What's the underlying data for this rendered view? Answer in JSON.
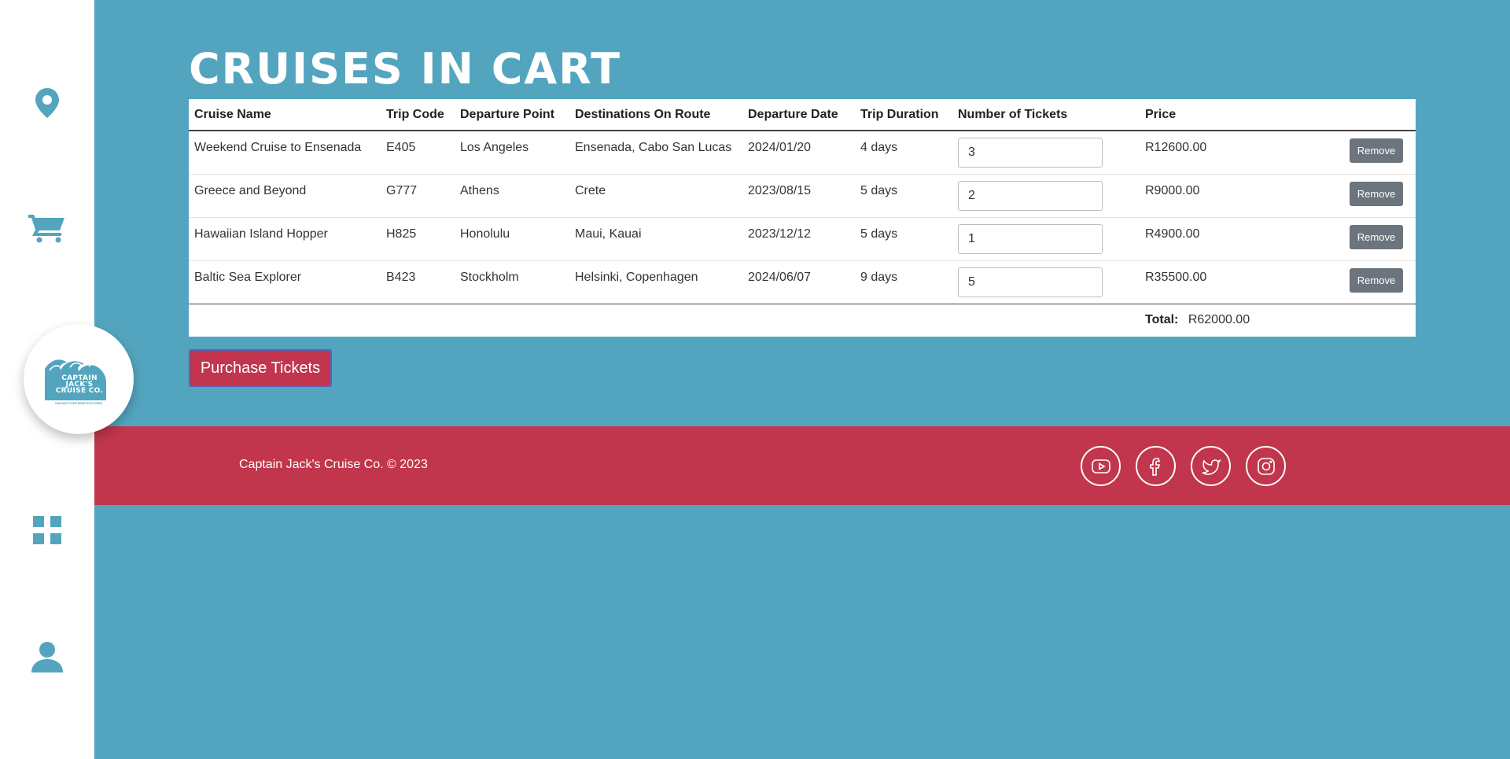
{
  "title": "Cruises in Cart",
  "brand": {
    "logo_line1": "CAPTAIN",
    "logo_line2": "JACK'S",
    "logo_line3": "CRUISE CO.",
    "logo_tagline": "UNLEASH YOUR INNER EXPLORER"
  },
  "nav": [
    {
      "icon": "map-pin-icon"
    },
    {
      "icon": "cart-icon"
    },
    {
      "icon": "grid-icon"
    },
    {
      "icon": "user-icon"
    }
  ],
  "table": {
    "headers": [
      "Cruise Name",
      "Trip Code",
      "Departure Point",
      "Destinations On Route",
      "Departure Date",
      "Trip Duration",
      "Number of Tickets",
      "Price",
      ""
    ],
    "rows": [
      {
        "name": "Weekend Cruise to Ensenada",
        "code": "E405",
        "departure": "Los Angeles",
        "destinations": "Ensenada, Cabo San Lucas",
        "date": "2024/01/20",
        "duration": "4 days",
        "tickets": "3",
        "price": "R12600.00",
        "remove": "Remove"
      },
      {
        "name": "Greece and Beyond",
        "code": "G777",
        "departure": "Athens",
        "destinations": "Crete",
        "date": "2023/08/15",
        "duration": "5 days",
        "tickets": "2",
        "price": "R9000.00",
        "remove": "Remove"
      },
      {
        "name": "Hawaiian Island Hopper",
        "code": "H825",
        "departure": "Honolulu",
        "destinations": "Maui, Kauai",
        "date": "2023/12/12",
        "duration": "5 days",
        "tickets": "1",
        "price": "R4900.00",
        "remove": "Remove"
      },
      {
        "name": "Baltic Sea Explorer",
        "code": "B423",
        "departure": "Stockholm",
        "destinations": "Helsinki, Copenhagen",
        "date": "2024/06/07",
        "duration": "9 days",
        "tickets": "5",
        "price": "R35500.00",
        "remove": "Remove"
      }
    ],
    "total_label": "Total:",
    "total_value": "R62000.00"
  },
  "purchase_label": "Purchase Tickets",
  "footer": {
    "copyright": "Captain Jack's Cruise Co. © 2023",
    "social": [
      "youtube-icon",
      "facebook-icon",
      "twitter-icon",
      "instagram-icon"
    ]
  },
  "colors": {
    "background": "#53a5bf",
    "accent": "#c1364c",
    "sidebar": "#ffffff",
    "remove_button": "#6c757d"
  }
}
